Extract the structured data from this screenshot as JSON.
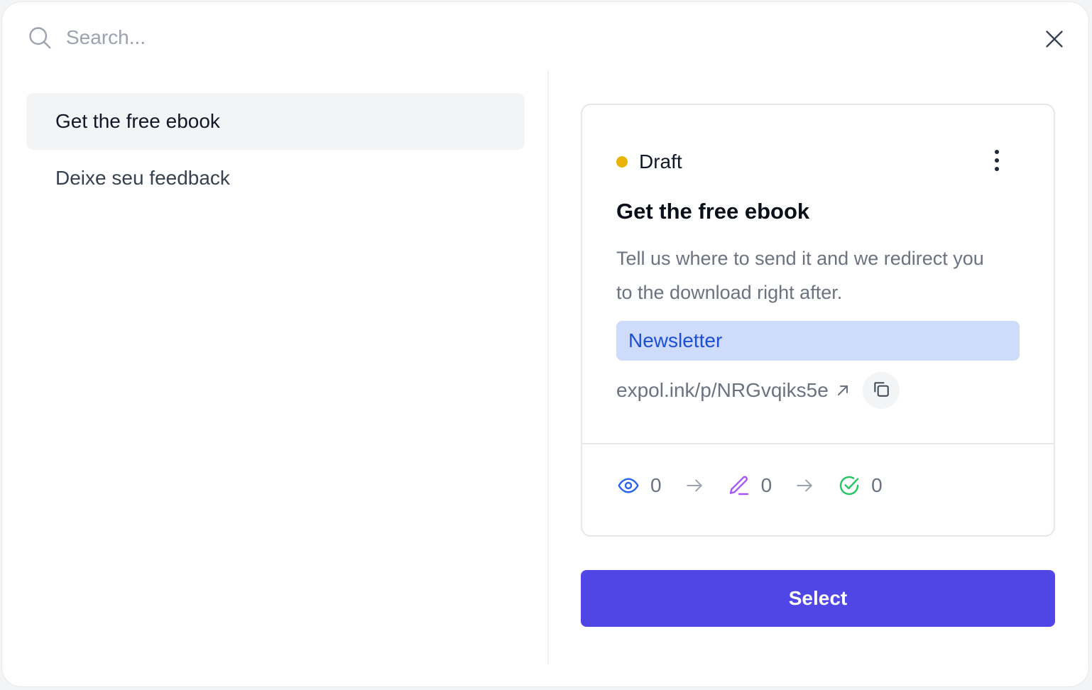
{
  "search": {
    "placeholder": "Search..."
  },
  "list": {
    "items": [
      {
        "label": "Get the free ebook"
      },
      {
        "label": "Deixe seu feedback"
      }
    ]
  },
  "card": {
    "status": "Draft",
    "status_color": "#eab308",
    "title": "Get the free ebook",
    "description": "Tell us where to send it and we redirect you to the download right after.",
    "tag": "Newsletter",
    "link": "expol.ink/p/NRGvqiks5e",
    "stats": {
      "views": "0",
      "started": "0",
      "completed": "0"
    },
    "icons": {
      "views": "eye-icon",
      "started": "pencil-icon",
      "completed": "check-circle-icon",
      "arrow": "arrow-right-icon",
      "copy": "copy-icon",
      "more": "more-vertical-icon",
      "external": "external-link-icon"
    }
  },
  "actions": {
    "select_label": "Select"
  },
  "colors": {
    "accent": "#4f46e5",
    "views": "#2563eb",
    "started": "#a855f7",
    "completed": "#22c55e"
  }
}
